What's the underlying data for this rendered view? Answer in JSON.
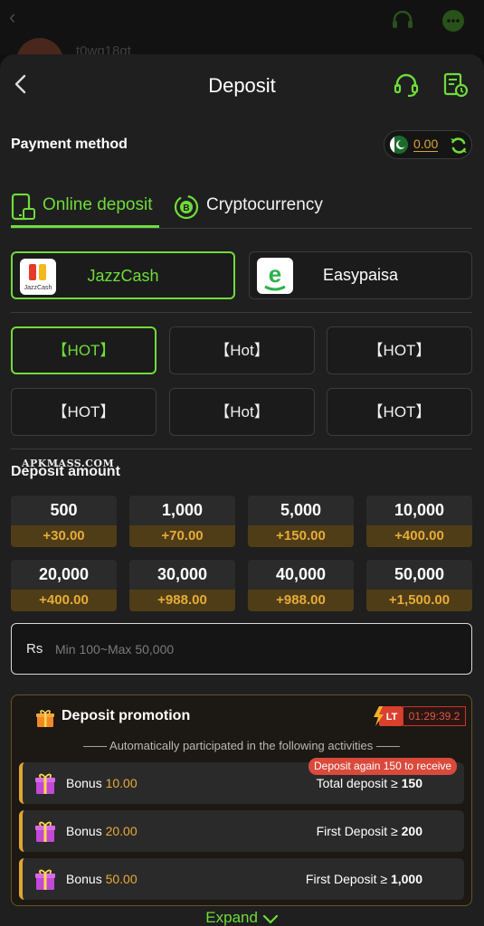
{
  "background": {
    "username": "t0wq18qt"
  },
  "header": {
    "title": "Deposit"
  },
  "payment_method_label": "Payment method",
  "balance": {
    "amount": "0.00"
  },
  "tabs": [
    {
      "label": "Online deposit",
      "active": true
    },
    {
      "label": "Cryptocurrency",
      "active": false
    }
  ],
  "methods": [
    {
      "name": "JazzCash",
      "logo_text": "JazzCash",
      "selected": true
    },
    {
      "name": "Easypaisa",
      "logo_text": "e",
      "selected": false
    }
  ],
  "channels": [
    {
      "label": "【HOT】",
      "selected": true
    },
    {
      "label": "【Hot】",
      "selected": false
    },
    {
      "label": "【HOT】",
      "selected": false
    },
    {
      "label": "【HOT】",
      "selected": false
    },
    {
      "label": "【Hot】",
      "selected": false
    },
    {
      "label": "【HOT】",
      "selected": false
    }
  ],
  "watermark": "APKMASS.COM",
  "deposit_amount_label": "Deposit amount",
  "amounts": [
    {
      "value": "500",
      "bonus": "+30.00"
    },
    {
      "value": "1,000",
      "bonus": "+70.00"
    },
    {
      "value": "5,000",
      "bonus": "+150.00"
    },
    {
      "value": "10,000",
      "bonus": "+400.00"
    },
    {
      "value": "20,000",
      "bonus": "+400.00"
    },
    {
      "value": "30,000",
      "bonus": "+988.00"
    },
    {
      "value": "40,000",
      "bonus": "+988.00"
    },
    {
      "value": "50,000",
      "bonus": "+1,500.00"
    }
  ],
  "input": {
    "currency": "Rs",
    "placeholder": "Min 100~Max 50,000",
    "value": ""
  },
  "promotion": {
    "title": "Deposit promotion",
    "badge": "LT",
    "timer": "01:29:39.2",
    "subtitle": "—— Automatically participated in the following activities ——",
    "again_tag": "Deposit again 150 to receive",
    "rows": [
      {
        "label": "Bonus",
        "amount": "10.00",
        "condition": "Total deposit ≥",
        "threshold": "150"
      },
      {
        "label": "Bonus",
        "amount": "20.00",
        "condition": "First Deposit ≥",
        "threshold": "200"
      },
      {
        "label": "Bonus",
        "amount": "50.00",
        "condition": "First Deposit ≥",
        "threshold": "1,000"
      }
    ]
  },
  "expand_label": "Expand",
  "colors": {
    "accent": "#6fdc3a",
    "gold": "#e7ab37",
    "background": "#1f1f1f"
  }
}
